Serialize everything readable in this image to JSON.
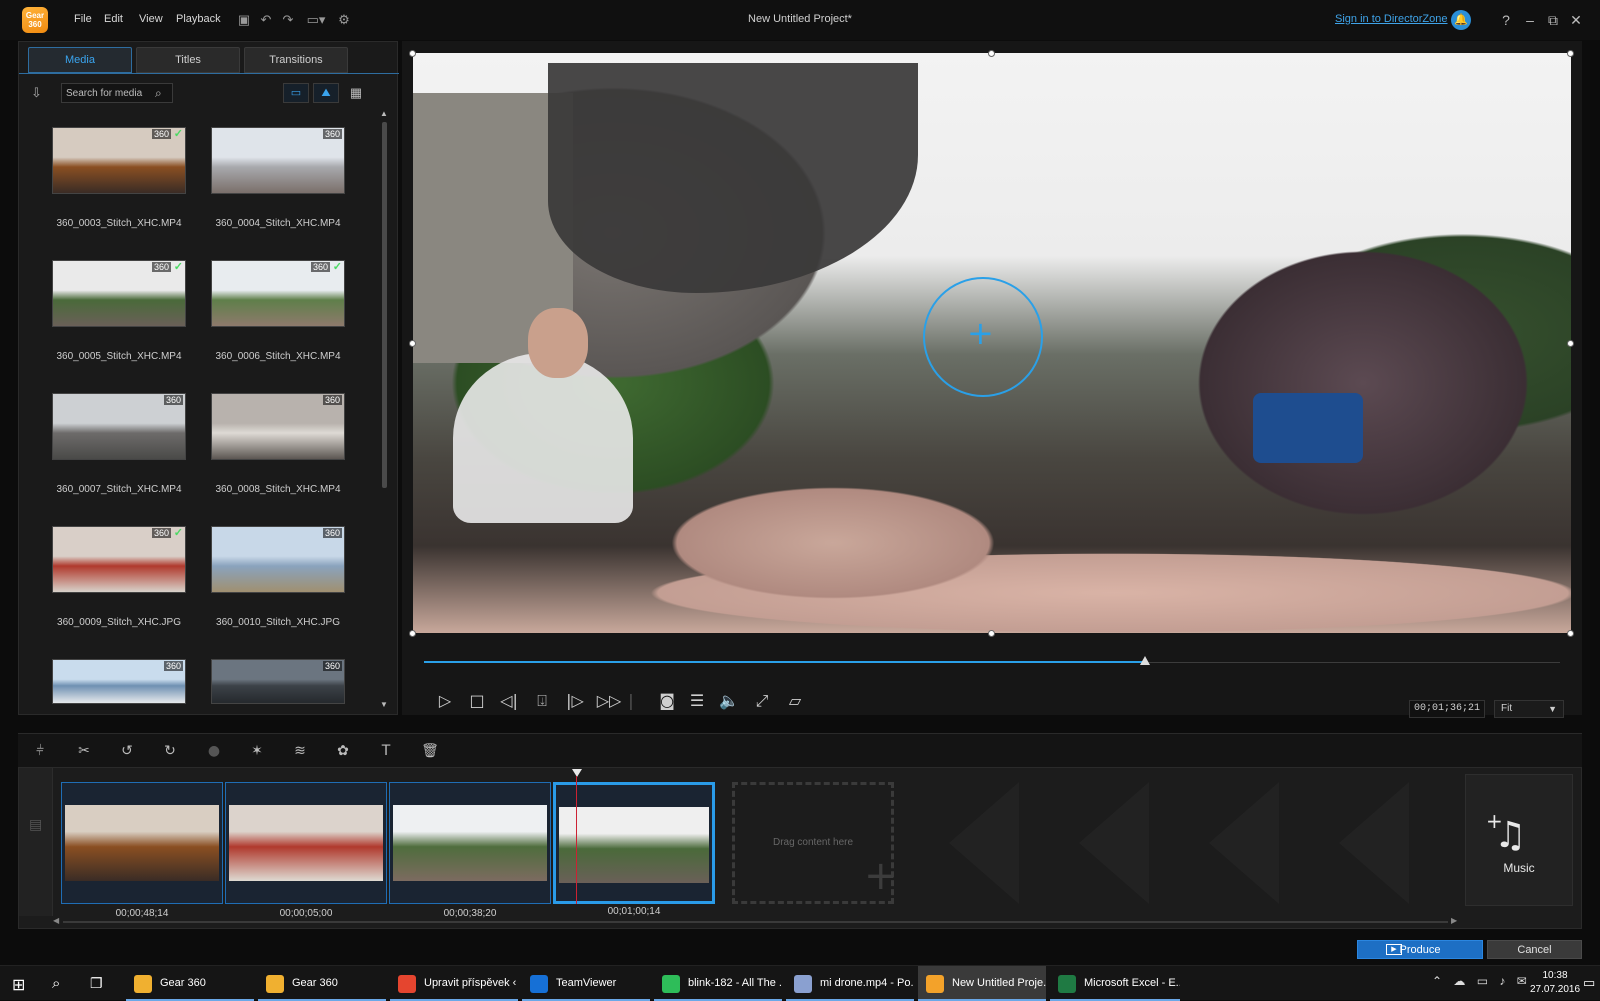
{
  "app": {
    "logo_text": "Gear 360",
    "title": "New Untitled Project*",
    "menu": [
      "File",
      "Edit",
      "View",
      "Playback"
    ],
    "sign_in": "Sign in to DirectorZone",
    "window_controls": [
      "?",
      "–",
      "⧉",
      "✕"
    ]
  },
  "library": {
    "tabs": [
      "Media",
      "Titles",
      "Transitions"
    ],
    "active_tab": "Media",
    "search_placeholder": "Search for media",
    "items": [
      {
        "name": "360_0003_Stitch_XHC.MP4",
        "badge": "360",
        "used": true,
        "colors": [
          "#d6cbc0",
          "#8a4f22",
          "#3a2c25"
        ]
      },
      {
        "name": "360_0004_Stitch_XHC.MP4",
        "badge": "360",
        "used": false,
        "colors": [
          "#dfe4ea",
          "#a8a9ad",
          "#7a6f6a"
        ]
      },
      {
        "name": "360_0005_Stitch_XHC.MP4",
        "badge": "360",
        "used": true,
        "colors": [
          "#eaeaea",
          "#4a6a3a",
          "#6a6058"
        ]
      },
      {
        "name": "360_0006_Stitch_XHC.MP4",
        "badge": "360",
        "used": true,
        "colors": [
          "#e8ecef",
          "#5f7f4a",
          "#8e7a6c"
        ]
      },
      {
        "name": "360_0007_Stitch_XHC.MP4",
        "badge": "360",
        "used": false,
        "colors": [
          "#cdd0d3",
          "#6d6b6a",
          "#4a4a48"
        ]
      },
      {
        "name": "360_0008_Stitch_XHC.MP4",
        "badge": "360",
        "used": false,
        "colors": [
          "#b8b2ad",
          "#dedad5",
          "#5d5753"
        ]
      },
      {
        "name": "360_0009_Stitch_XHC.JPG",
        "badge": "360",
        "used": true,
        "colors": [
          "#d9cfc8",
          "#b0392d",
          "#d8d2ca"
        ]
      },
      {
        "name": "360_0010_Stitch_XHC.JPG",
        "badge": "360",
        "used": false,
        "colors": [
          "#c8d8e8",
          "#8aa3bd",
          "#a09070"
        ]
      },
      {
        "name": "",
        "badge": "360",
        "used": false,
        "colors": [
          "#c9dced",
          "#6f90b2",
          "#e6e9ec"
        ]
      },
      {
        "name": "",
        "badge": "360",
        "used": false,
        "colors": [
          "#6b7580",
          "#3c4248",
          "#25292d"
        ]
      }
    ]
  },
  "preview": {
    "timecode": "00;01;36;21",
    "zoom": "Fit",
    "progress": 0.635
  },
  "controls": [
    "play",
    "stop",
    "prev-frame",
    "snapshot-marker",
    "next-frame",
    "fast-forward",
    "camera",
    "subtitle",
    "volume",
    "fullscreen",
    "external-display"
  ],
  "edit_tools": [
    "split-icon",
    "trim-icon",
    "rotate-left-icon",
    "rotate-right-icon",
    "fix-enhance-icon",
    "effect-icon",
    "speed-icon",
    "particle-icon",
    "title-icon",
    "delete-icon"
  ],
  "storyboard": {
    "clips": [
      {
        "duration": "00;00;48;14",
        "colors": [
          "#d9cec2",
          "#8a4f22",
          "#3a2c25"
        ],
        "selected": false
      },
      {
        "duration": "00;00;05;00",
        "colors": [
          "#dcd3cc",
          "#b0392d",
          "#dedad2"
        ],
        "selected": false
      },
      {
        "duration": "00;00;38;20",
        "colors": [
          "#eef0f2",
          "#4f6d3d",
          "#7c6b60"
        ],
        "selected": false
      },
      {
        "duration": "00;01;00;14",
        "colors": [
          "#efefef",
          "#4a6a3a",
          "#6a6058"
        ],
        "selected": true
      }
    ],
    "drop_label": "Drag content here",
    "music_label": "Music"
  },
  "actions": {
    "produce": "Produce",
    "cancel": "Cancel"
  },
  "taskbar": {
    "items": [
      {
        "label": "Gear 360",
        "color": "#f0b030",
        "active": false
      },
      {
        "label": "Gear 360",
        "color": "#f0b030",
        "active": false
      },
      {
        "label": "Upravit příspěvek ‹ ...",
        "color": "#e5452f",
        "active": false
      },
      {
        "label": "TeamViewer",
        "color": "#1670d6",
        "active": false
      },
      {
        "label": "blink-182 - All The ...",
        "color": "#2ebd59",
        "active": false
      },
      {
        "label": "mi drone.mp4 - Po...",
        "color": "#8aa0d0",
        "active": false
      },
      {
        "label": "New Untitled Proje...",
        "color": "#f3a22a",
        "active": true
      },
      {
        "label": "Microsoft Excel - E...",
        "color": "#1f7a43",
        "active": false
      }
    ],
    "time": "10:38",
    "date": "27.07.2016"
  }
}
